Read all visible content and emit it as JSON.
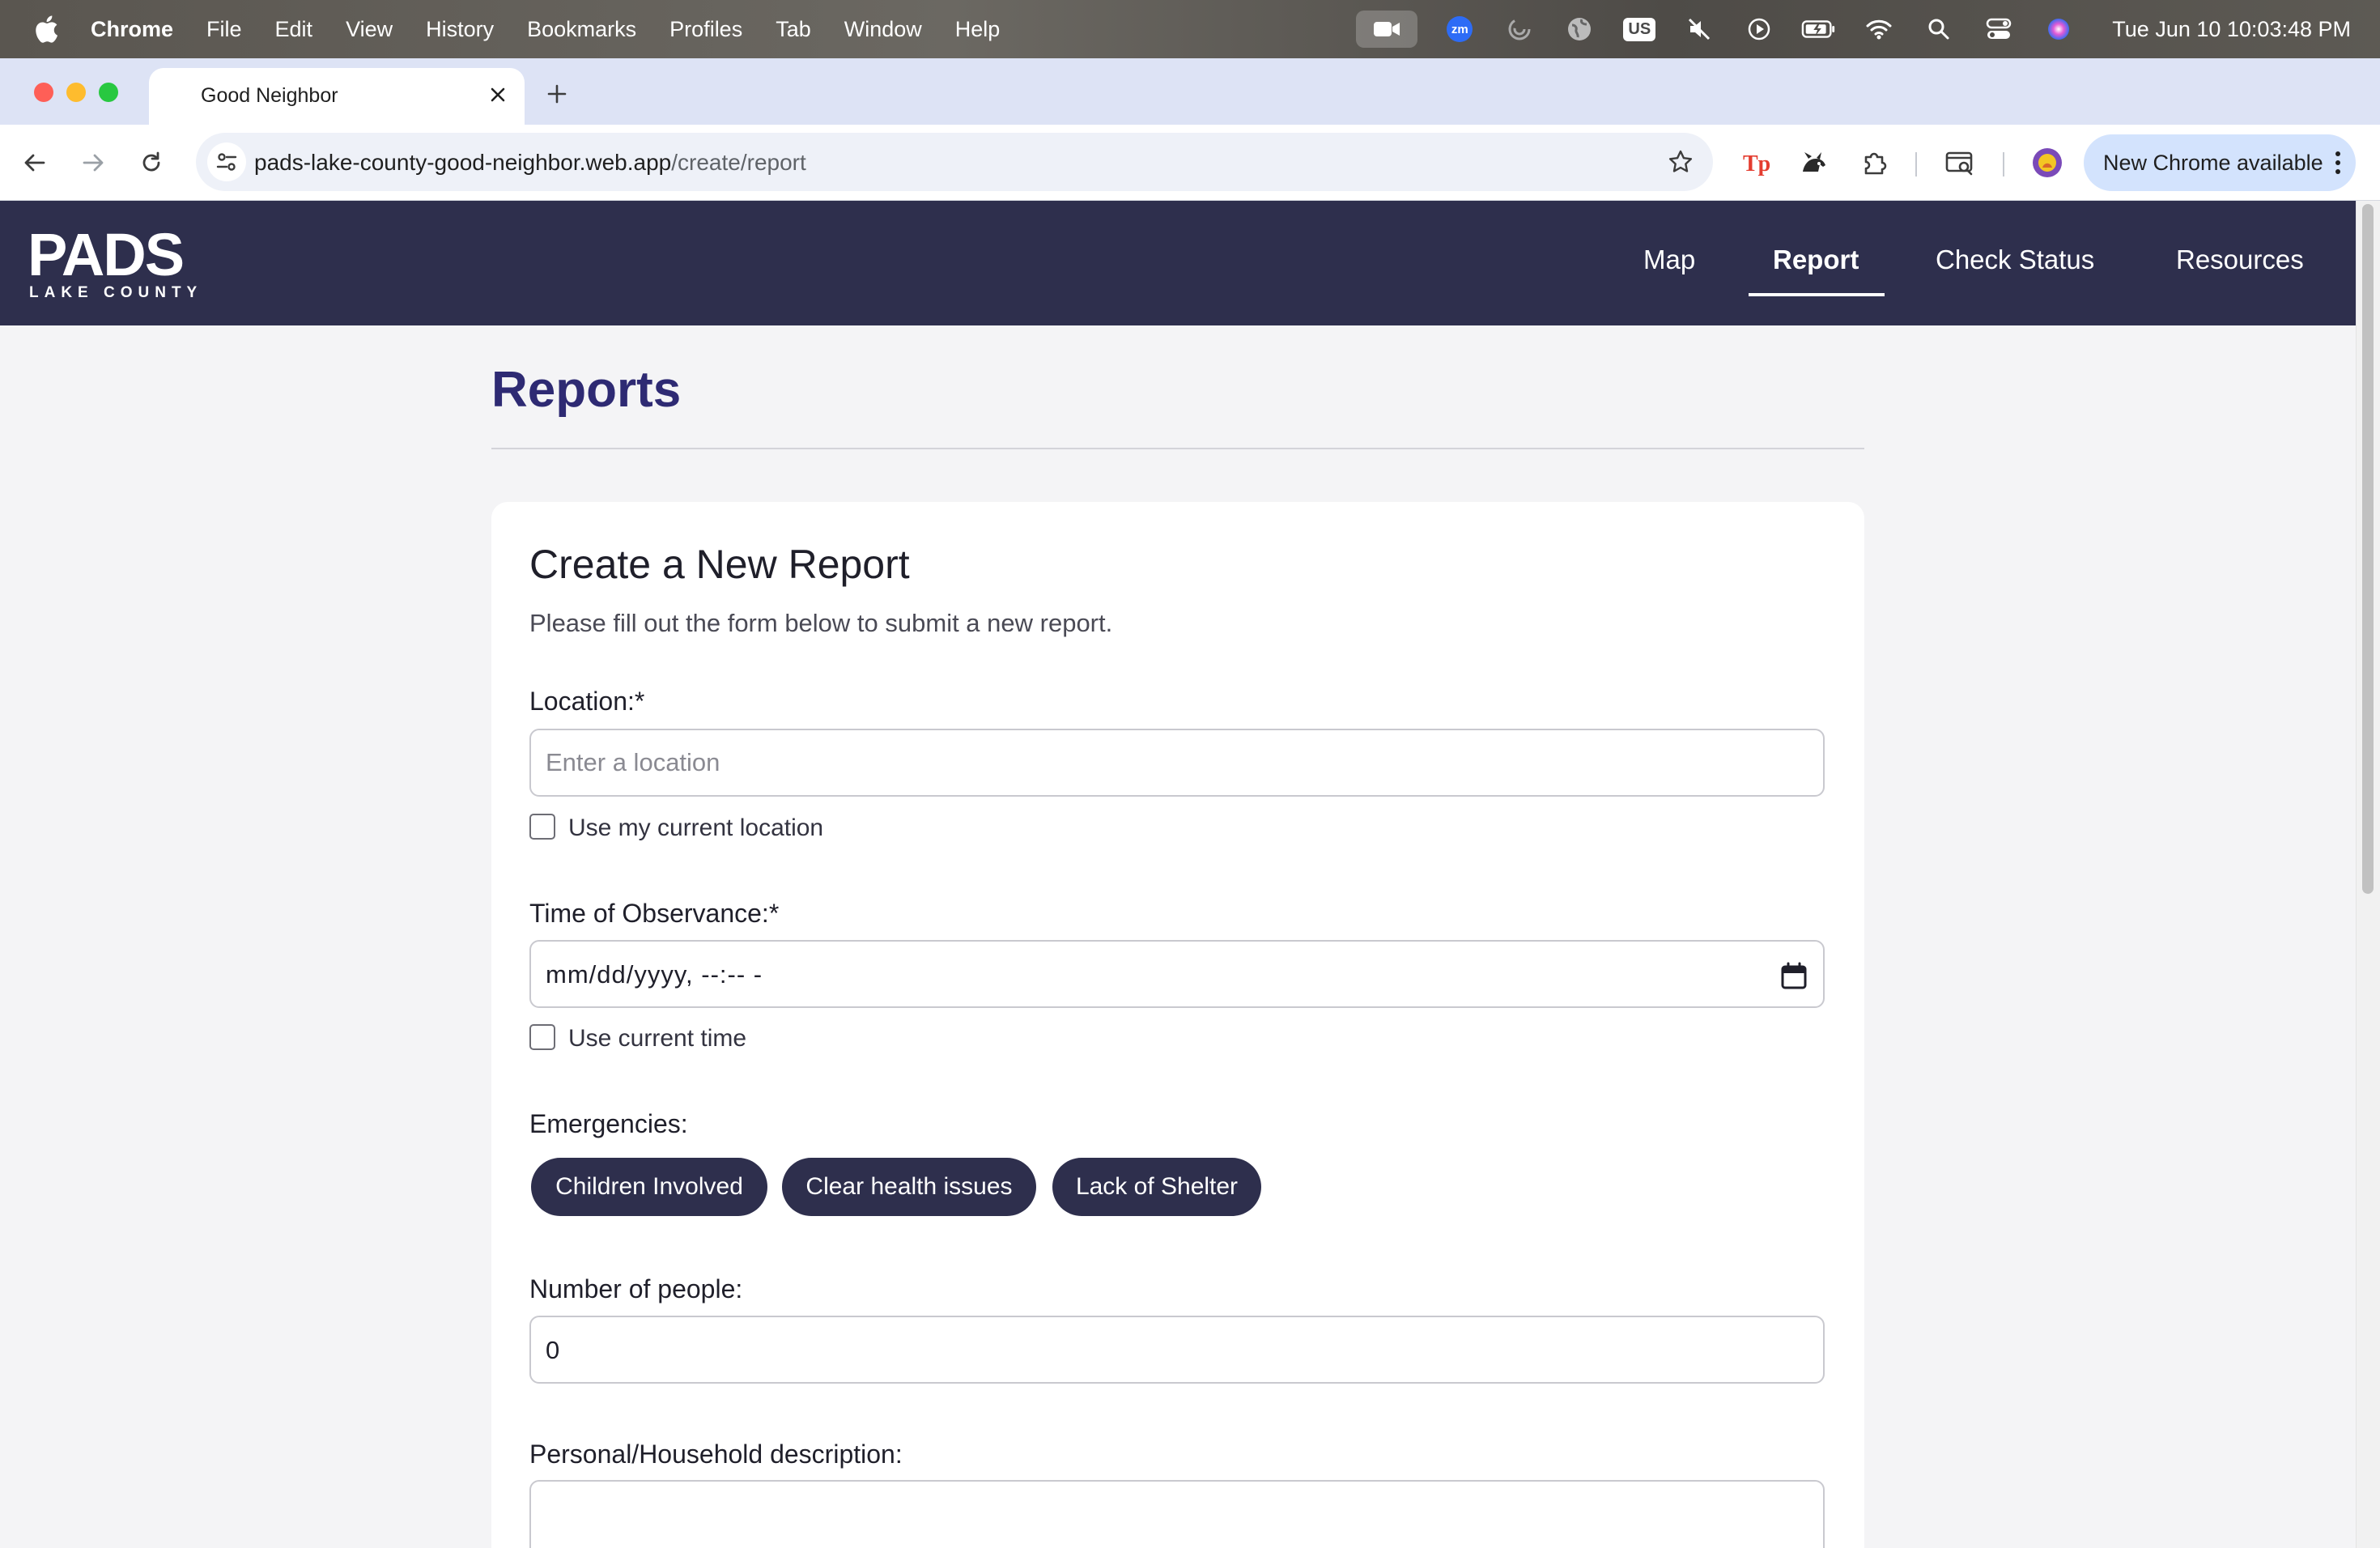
{
  "menubar": {
    "app": "Chrome",
    "items": [
      "File",
      "Edit",
      "View",
      "History",
      "Bookmarks",
      "Profiles",
      "Tab",
      "Window",
      "Help"
    ],
    "status_icons": [
      "video-icon",
      "zoom-icon",
      "loader-icon",
      "globe-icon",
      "keyboard-input-icon",
      "mute-icon",
      "play-icon",
      "battery-icon",
      "wifi-icon",
      "spotlight-icon",
      "control-center-icon",
      "siri-icon"
    ],
    "input_source": "US",
    "zoom_badge": "zm",
    "clock": "Tue Jun 10  10:03:48 PM"
  },
  "browser": {
    "tab_title": "Good Neighbor",
    "url_domain": "pads-lake-county-good-neighbor.web.app",
    "url_path": "/create/report",
    "update_label": "New Chrome available"
  },
  "site": {
    "logo_text": "PADS",
    "logo_subtext": "LAKE COUNTY",
    "nav": [
      "Map",
      "Report",
      "Check Status",
      "Resources"
    ],
    "active_nav": "Report"
  },
  "page": {
    "title": "Reports"
  },
  "form": {
    "title": "Create a New Report",
    "subtitle": "Please fill out the form below to submit a new report.",
    "location_label": "Location:*",
    "location_placeholder": "Enter a location",
    "location_checkbox": "Use my current location",
    "time_label": "Time of Observance:*",
    "time_value": "mm/dd/yyyy, --:-- -",
    "time_checkbox": "Use current time",
    "emergencies_label": "Emergencies:",
    "emergencies": [
      "Children Involved",
      "Clear health issues",
      "Lack of Shelter"
    ],
    "people_label": "Number of people:",
    "people_value": "0",
    "description_label": "Personal/Household description:"
  },
  "colors": {
    "header_bg": "#2e2f4d",
    "title_color": "#2e2a73",
    "pill_bg": "#2e2f4d",
    "page_bg": "#f4f4f6"
  }
}
